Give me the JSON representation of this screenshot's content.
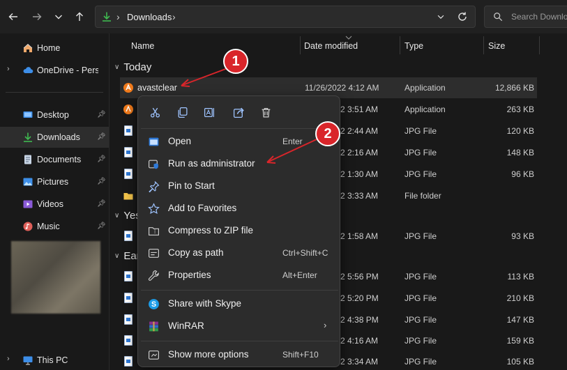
{
  "toolbar": {
    "breadcrumb": "Downloads",
    "search_placeholder": "Search Downloads"
  },
  "sidebar": {
    "items": [
      {
        "label": "Home"
      },
      {
        "label": "OneDrive - Personal"
      },
      {
        "label": "Desktop"
      },
      {
        "label": "Downloads"
      },
      {
        "label": "Documents"
      },
      {
        "label": "Pictures"
      },
      {
        "label": "Videos"
      },
      {
        "label": "Music"
      },
      {
        "label": "This PC"
      }
    ]
  },
  "columns": {
    "name": "Name",
    "date": "Date modified",
    "type": "Type",
    "size": "Size"
  },
  "groups": {
    "today": "Today",
    "yesterday": "Yes",
    "earlier": "Ear"
  },
  "rows": [
    {
      "name": "avastclear",
      "date": "11/26/2022 4:12 AM",
      "type": "Application",
      "size": "12,866 KB"
    },
    {
      "name": "",
      "date": "2 3:51 AM",
      "type": "Application",
      "size": "263 KB"
    },
    {
      "name": "",
      "date": "2 2:44 AM",
      "type": "JPG File",
      "size": "120 KB"
    },
    {
      "name": "",
      "date": "2 2:16 AM",
      "type": "JPG File",
      "size": "148 KB"
    },
    {
      "name": "",
      "date": "2 1:30 AM",
      "type": "JPG File",
      "size": "96 KB"
    },
    {
      "name": "",
      "date": "2 3:33 AM",
      "type": "File folder",
      "size": ""
    },
    {
      "name": "",
      "date": "2 1:58 AM",
      "type": "JPG File",
      "size": "93 KB"
    },
    {
      "name": "",
      "date": "2 5:56 PM",
      "type": "JPG File",
      "size": "113 KB"
    },
    {
      "name": "",
      "date": "2 5:20 PM",
      "type": "JPG File",
      "size": "210 KB"
    },
    {
      "name": "",
      "date": "2 4:38 PM",
      "type": "JPG File",
      "size": "147 KB"
    },
    {
      "name": "",
      "date": "2 4:16 AM",
      "type": "JPG File",
      "size": "159 KB"
    },
    {
      "name": "",
      "date": "2 3:34 AM",
      "type": "JPG File",
      "size": "105 KB"
    }
  ],
  "context_menu": {
    "items": [
      {
        "label": "Open",
        "shortcut": "Enter"
      },
      {
        "label": "Run as administrator",
        "shortcut": ""
      },
      {
        "label": "Pin to Start",
        "shortcut": ""
      },
      {
        "label": "Add to Favorites",
        "shortcut": ""
      },
      {
        "label": "Compress to ZIP file",
        "shortcut": ""
      },
      {
        "label": "Copy as path",
        "shortcut": "Ctrl+Shift+C"
      },
      {
        "label": "Properties",
        "shortcut": "Alt+Enter"
      },
      {
        "label": "Share with Skype",
        "shortcut": ""
      },
      {
        "label": "WinRAR",
        "shortcut": ""
      },
      {
        "label": "Show more options",
        "shortcut": "Shift+F10"
      }
    ]
  },
  "annotations": {
    "step1": "1",
    "step2": "2"
  },
  "colors": {
    "accent_green": "#3fb950",
    "annotation_red": "#d9252a",
    "background": "#191919"
  }
}
